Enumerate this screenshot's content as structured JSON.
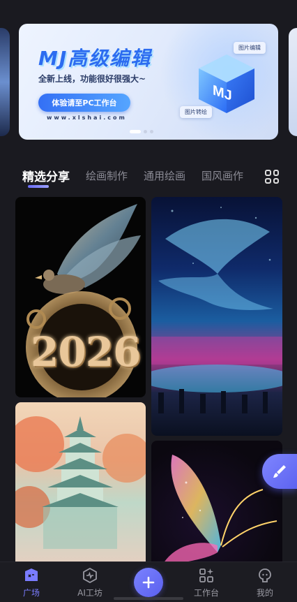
{
  "banner": {
    "title": "MJ高级编辑",
    "subtitle": "全新上线，功能很好很强大~",
    "cta": "体验请至PC工作台",
    "url": "www.xlshai.com",
    "tag_edit": "图片编辑",
    "tag_convert": "图片转绘",
    "cube_label": "MJ"
  },
  "tabs": [
    {
      "label": "精选分享",
      "active": true
    },
    {
      "label": "绘画制作",
      "active": false
    },
    {
      "label": "通用绘画",
      "active": false
    },
    {
      "label": "国风画作",
      "active": false
    }
  ],
  "feed": {
    "card1_text": "2026"
  },
  "nav": {
    "square": "广场",
    "ai_workshop": "AI工坊",
    "workbench": "工作台",
    "mine": "我的"
  },
  "colors": {
    "accent": "#6a6cf6",
    "background": "#1a1a20"
  },
  "icons": {
    "grid": "grid-icon",
    "brush": "brush-icon",
    "plus": "plus-icon"
  }
}
